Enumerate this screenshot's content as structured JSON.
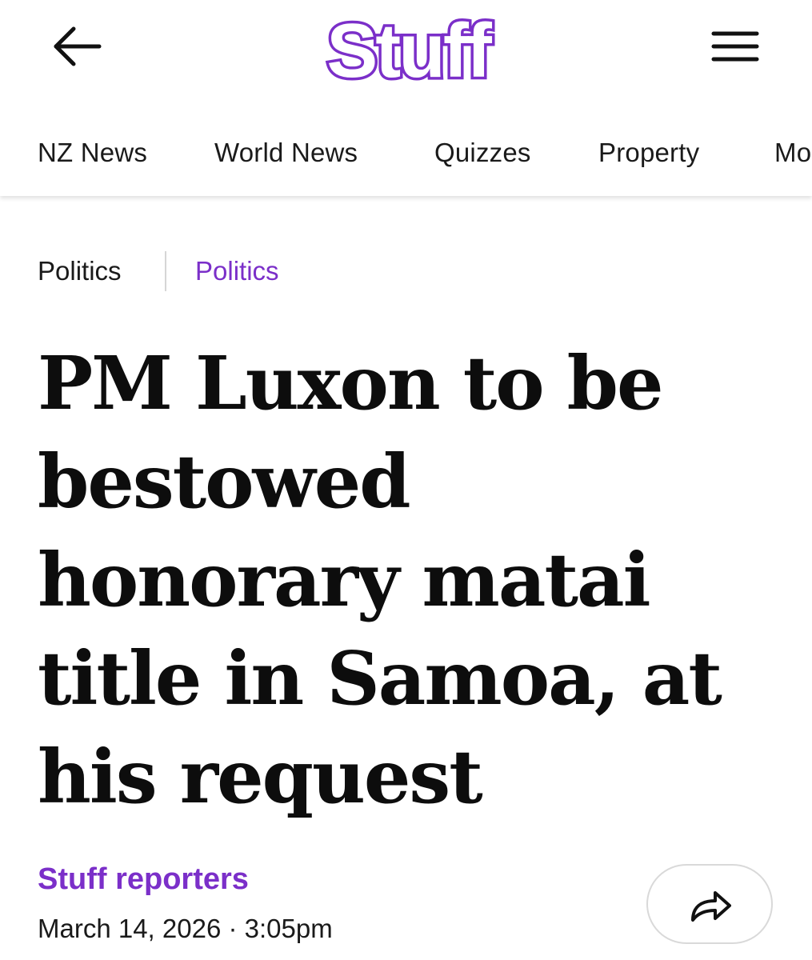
{
  "header": {
    "back_icon": "arrow-left-icon",
    "brand": "Stuff",
    "brand_color": "#7b2fc9",
    "menu_icon": "hamburger-menu-icon"
  },
  "nav": {
    "items": [
      {
        "label": "NZ News"
      },
      {
        "label": "World News"
      },
      {
        "label": "Quizzes"
      },
      {
        "label": "Property"
      },
      {
        "label": "Mo"
      }
    ]
  },
  "breadcrumb": {
    "section": "Politics",
    "subsection": "Politics",
    "subsection_color": "#7b2fc9"
  },
  "article": {
    "headline_lines": [
      "PM Luxon to be",
      "bestowed",
      "honorary matai",
      "title in Samoa, at",
      "his request"
    ],
    "author": "Stuff reporters",
    "date": "March 14, 2026",
    "separator": "·",
    "time": "3:05pm",
    "share_icon": "share-arrow-icon"
  }
}
